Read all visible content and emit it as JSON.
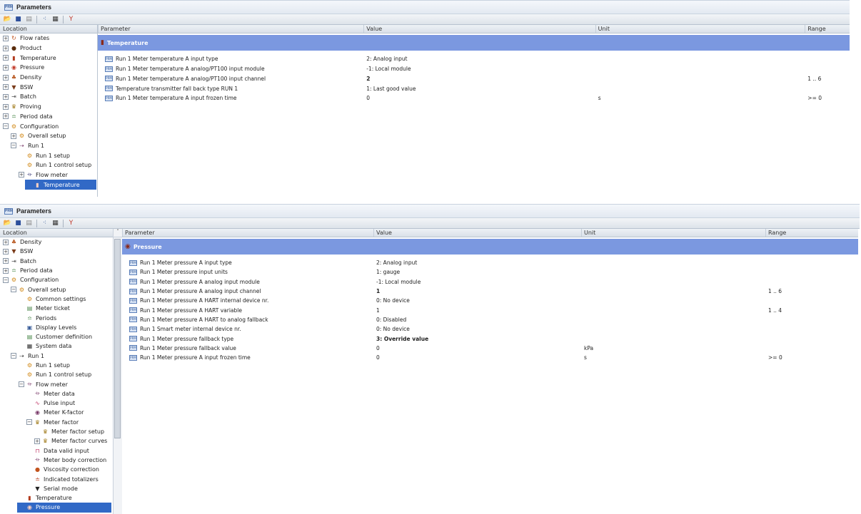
{
  "panels": [
    {
      "title": "Parameters",
      "tree_header": "Location",
      "columns": [
        "Parameter",
        "Value",
        "Unit",
        "Range"
      ],
      "tree": [
        {
          "label": "Flow rates",
          "toggle": "+",
          "icon": "flow-rates-icon",
          "glyph": "↻",
          "color": "#c2531d",
          "indent": 0
        },
        {
          "label": "Product",
          "toggle": "+",
          "icon": "product-drop-icon",
          "glyph": "●",
          "color": "#5a2d0c",
          "indent": 0
        },
        {
          "label": "Temperature",
          "toggle": "+",
          "icon": "thermometer-icon",
          "glyph": "▮",
          "color": "#b23b1e",
          "indent": 0
        },
        {
          "label": "Pressure",
          "toggle": "+",
          "icon": "pressure-gauge-icon",
          "glyph": "◉",
          "color": "#c23b2a",
          "indent": 0
        },
        {
          "label": "Density",
          "toggle": "+",
          "icon": "density-icon",
          "glyph": "♣",
          "color": "#b8571f",
          "indent": 0
        },
        {
          "label": "BSW",
          "toggle": "+",
          "icon": "funnel-icon",
          "glyph": "▼",
          "color": "#7a3b1a",
          "indent": 0
        },
        {
          "label": "Batch",
          "toggle": "+",
          "icon": "batch-icon",
          "glyph": "⇥",
          "color": "#555555",
          "indent": 0
        },
        {
          "label": "Proving",
          "toggle": "+",
          "icon": "proving-icon",
          "glyph": "♛",
          "color": "#a07a1a",
          "indent": 0
        },
        {
          "label": "Period data",
          "toggle": "+",
          "icon": "period-data-icon",
          "glyph": "≏",
          "color": "#4d8a4d",
          "indent": 0
        },
        {
          "label": "Configuration",
          "toggle": "−",
          "icon": "configuration-icon",
          "glyph": "⚙",
          "color": "#d28a1a",
          "indent": 0
        },
        {
          "label": "Overall setup",
          "toggle": "+",
          "icon": "overall-setup-icon",
          "glyph": "⚙",
          "color": "#d28a1a",
          "indent": 1
        },
        {
          "label": "Run 1",
          "toggle": "−",
          "icon": "run-icon",
          "glyph": "⇢",
          "color": "#7a3b6a",
          "indent": 1
        },
        {
          "label": "Run 1 setup",
          "toggle": "",
          "icon": "run-setup-icon",
          "glyph": "⚙",
          "color": "#d28a1a",
          "indent": 2
        },
        {
          "label": "Run 1 control setup",
          "toggle": "",
          "icon": "run-control-setup-icon",
          "glyph": "⚙",
          "color": "#d28a1a",
          "indent": 2
        },
        {
          "label": "Flow meter",
          "toggle": "+",
          "icon": "flow-meter-icon",
          "glyph": "⟛",
          "color": "#3b3b7a",
          "indent": 2
        },
        {
          "label": "Temperature",
          "toggle": "",
          "icon": "thermometer-icon",
          "glyph": "▮",
          "color": "#b23b1e",
          "indent": 3,
          "selected": true
        }
      ],
      "group": {
        "label": "Temperature",
        "icon": "thermometer-icon",
        "glyph": "▮"
      },
      "rows": [
        {
          "parameter": "Run 1 Meter temperature A input type",
          "value": "2: Analog input",
          "unit": "",
          "range": "",
          "bold": false
        },
        {
          "parameter": "Run 1 Meter temperature A analog/PT100 input module",
          "value": "-1: Local module",
          "unit": "",
          "range": "",
          "bold": false
        },
        {
          "parameter": "Run 1 Meter temperature A analog/PT100 input channel",
          "value": "2",
          "unit": "",
          "range": "1 .. 6",
          "bold": true
        },
        {
          "parameter": "Temperature transmitter fall back type RUN 1",
          "value": "1: Last good value",
          "unit": "",
          "range": "",
          "bold": false
        },
        {
          "parameter": "Run 1 Meter temperature A input frozen time",
          "value": "0",
          "unit": "s",
          "range": ">= 0",
          "bold": false
        }
      ]
    },
    {
      "title": "Parameters",
      "tree_header": "Location",
      "columns": [
        "Parameter",
        "Value",
        "Unit",
        "Range"
      ],
      "tree": [
        {
          "label": "Density",
          "toggle": "+",
          "icon": "density-icon",
          "glyph": "♣",
          "color": "#b8571f",
          "indent": 0
        },
        {
          "label": "BSW",
          "toggle": "+",
          "icon": "funnel-icon",
          "glyph": "▼",
          "color": "#7a3b1a",
          "indent": 0
        },
        {
          "label": "Batch",
          "toggle": "+",
          "icon": "batch-icon",
          "glyph": "⇥",
          "color": "#555555",
          "indent": 0
        },
        {
          "label": "Period data",
          "toggle": "+",
          "icon": "period-data-icon",
          "glyph": "≏",
          "color": "#4d8a4d",
          "indent": 0
        },
        {
          "label": "Configuration",
          "toggle": "−",
          "icon": "configuration-icon",
          "glyph": "⚙",
          "color": "#d28a1a",
          "indent": 0
        },
        {
          "label": "Overall setup",
          "toggle": "−",
          "icon": "overall-setup-icon",
          "glyph": "⚙",
          "color": "#d28a1a",
          "indent": 1
        },
        {
          "label": "Common settings",
          "toggle": "",
          "icon": "common-settings-icon",
          "glyph": "⚙",
          "color": "#d28a1a",
          "indent": 2
        },
        {
          "label": "Meter ticket",
          "toggle": "",
          "icon": "meter-ticket-icon",
          "glyph": "▤",
          "color": "#4d8a4d",
          "indent": 2
        },
        {
          "label": "Periods",
          "toggle": "",
          "icon": "periods-icon",
          "glyph": "≏",
          "color": "#4d8a4d",
          "indent": 2
        },
        {
          "label": "Display Levels",
          "toggle": "",
          "icon": "display-levels-icon",
          "glyph": "▣",
          "color": "#3b5f9b",
          "indent": 2
        },
        {
          "label": "Customer definition",
          "toggle": "",
          "icon": "customer-definition-icon",
          "glyph": "▤",
          "color": "#4d8a4d",
          "indent": 2
        },
        {
          "label": "System data",
          "toggle": "",
          "icon": "system-data-icon",
          "glyph": "▦",
          "color": "#333333",
          "indent": 2
        },
        {
          "label": "Run 1",
          "toggle": "−",
          "icon": "run-icon",
          "glyph": "⇢",
          "color": "#333333",
          "indent": 1
        },
        {
          "label": "Run 1 setup",
          "toggle": "",
          "icon": "run-setup-icon",
          "glyph": "⚙",
          "color": "#d28a1a",
          "indent": 2
        },
        {
          "label": "Run 1 control setup",
          "toggle": "",
          "icon": "run-control-setup-icon",
          "glyph": "⚙",
          "color": "#d28a1a",
          "indent": 2
        },
        {
          "label": "Flow meter",
          "toggle": "−",
          "icon": "flow-meter-icon",
          "glyph": "⟛",
          "color": "#7a3b6a",
          "indent": 2
        },
        {
          "label": "Meter data",
          "toggle": "",
          "icon": "meter-data-icon",
          "glyph": "⟛",
          "color": "#7a3b6a",
          "indent": 3
        },
        {
          "label": "Pulse input",
          "toggle": "",
          "icon": "pulse-input-icon",
          "glyph": "∿",
          "color": "#c23b6a",
          "indent": 3
        },
        {
          "label": "Meter K-factor",
          "toggle": "",
          "icon": "meter-k-factor-icon",
          "glyph": "◉",
          "color": "#7a3b6a",
          "indent": 3
        },
        {
          "label": "Meter factor",
          "toggle": "−",
          "icon": "meter-factor-icon",
          "glyph": "♛",
          "color": "#a07a1a",
          "indent": 3
        },
        {
          "label": "Meter factor setup",
          "toggle": "",
          "icon": "meter-factor-setup-icon",
          "glyph": "♛",
          "color": "#a07a1a",
          "indent": 4
        },
        {
          "label": "Meter factor curves",
          "toggle": "+",
          "icon": "meter-factor-curves-icon",
          "glyph": "♛",
          "color": "#a07a1a",
          "indent": 4
        },
        {
          "label": "Data valid input",
          "toggle": "",
          "icon": "data-valid-input-icon",
          "glyph": "⊓",
          "color": "#c23b6a",
          "indent": 3
        },
        {
          "label": "Meter body correction",
          "toggle": "",
          "icon": "meter-body-correction-icon",
          "glyph": "⟛",
          "color": "#7a3b6a",
          "indent": 3
        },
        {
          "label": "Viscosity correction",
          "toggle": "",
          "icon": "viscosity-correction-icon",
          "glyph": "●",
          "color": "#c2531d",
          "indent": 3
        },
        {
          "label": "Indicated totalizers",
          "toggle": "",
          "icon": "indicated-totalizers-icon",
          "glyph": "≐",
          "color": "#b23b1e",
          "indent": 3
        },
        {
          "label": "Serial mode",
          "toggle": "",
          "icon": "serial-mode-icon",
          "glyph": "▼",
          "color": "#222222",
          "indent": 3
        },
        {
          "label": "Temperature",
          "toggle": "",
          "icon": "thermometer-icon",
          "glyph": "▮",
          "color": "#b23b1e",
          "indent": 2
        },
        {
          "label": "Pressure",
          "toggle": "",
          "icon": "pressure-gauge-icon",
          "glyph": "◉",
          "color": "#c23b2a",
          "indent": 2,
          "selected": true
        }
      ],
      "group": {
        "label": "Pressure",
        "icon": "pressure-gauge-icon",
        "glyph": "◉"
      },
      "rows": [
        {
          "parameter": "Run 1 Meter pressure A input type",
          "value": "2: Analog input",
          "unit": "",
          "range": "",
          "bold": false
        },
        {
          "parameter": "Run 1 Meter pressure input units",
          "value": "1: gauge",
          "unit": "",
          "range": "",
          "bold": false
        },
        {
          "parameter": "Run 1 Meter pressure A analog input module",
          "value": "-1: Local module",
          "unit": "",
          "range": "",
          "bold": false
        },
        {
          "parameter": "Run 1 Meter pressure A analog input channel",
          "value": "1",
          "unit": "",
          "range": "1 .. 6",
          "bold": true
        },
        {
          "parameter": "Run 1 Meter pressure A HART internal device nr.",
          "value": "0: No device",
          "unit": "",
          "range": "",
          "bold": false
        },
        {
          "parameter": "Run 1 Meter pressure A HART variable",
          "value": "1",
          "unit": "",
          "range": "1 .. 4",
          "bold": false
        },
        {
          "parameter": "Run 1 Meter pressure A HART to analog fallback",
          "value": "0: Disabled",
          "unit": "",
          "range": "",
          "bold": false
        },
        {
          "parameter": "Run 1 Smart meter internal device nr.",
          "value": "0: No device",
          "unit": "",
          "range": "",
          "bold": false
        },
        {
          "parameter": "Run 1 Meter pressure fallback type",
          "value": "3: Override value",
          "unit": "",
          "range": "",
          "bold": true
        },
        {
          "parameter": "Run 1 Meter pressure fallback value",
          "value": "0",
          "unit": "kPa",
          "range": "",
          "bold": false
        },
        {
          "parameter": "Run 1 Meter pressure A input frozen time",
          "value": "0",
          "unit": "s",
          "range": ">= 0",
          "bold": false
        }
      ]
    }
  ],
  "toolbar": [
    {
      "icon": "open-folder-icon",
      "glyph": "📂",
      "color": "#d8a020"
    },
    {
      "icon": "save-icon",
      "glyph": "■",
      "color": "#2d4f9b"
    },
    {
      "icon": "print-icon",
      "glyph": "▤",
      "color": "#8a8a8a"
    },
    {
      "icon": "tree-view-icon",
      "glyph": "⁖",
      "color": "#3b5f9b"
    },
    {
      "icon": "grid-view-icon",
      "glyph": "▦",
      "color": "#333333"
    },
    {
      "icon": "filter-clear-icon",
      "glyph": "Y",
      "color": "#c0392b"
    }
  ],
  "row_icon_text": "PRM",
  "colors": {
    "group_header": "#7b98e0",
    "selection": "#3169c6"
  }
}
